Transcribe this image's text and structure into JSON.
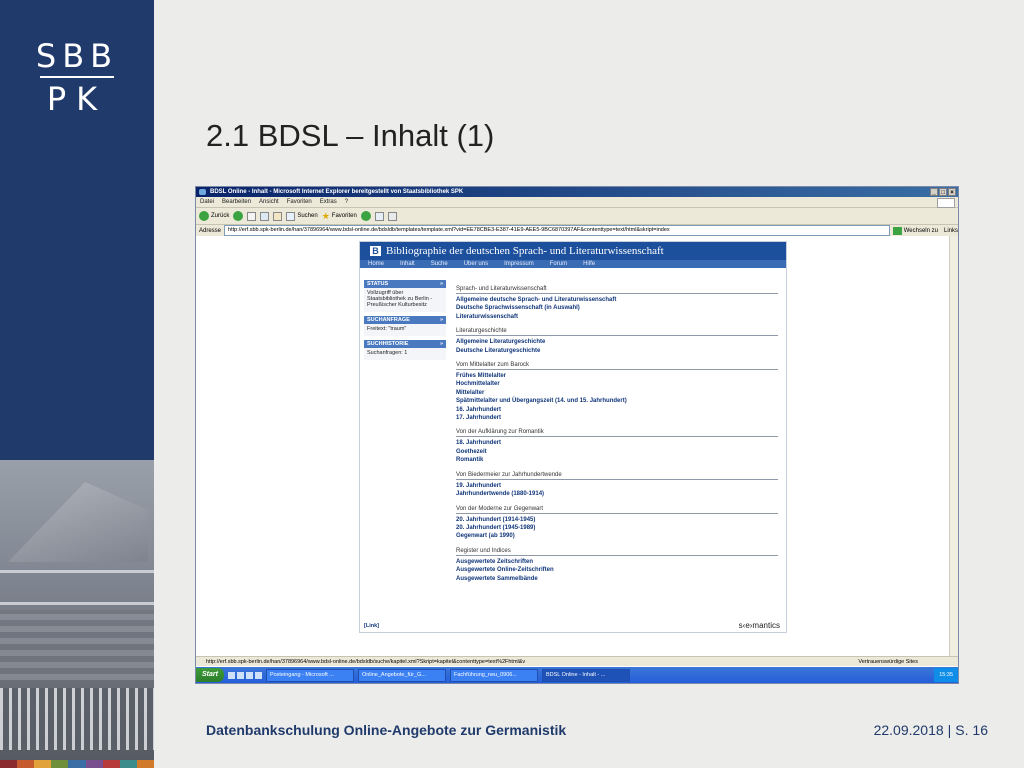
{
  "sidebar": {
    "logo_top": "SBB",
    "logo_bottom": "PK",
    "strip_colors": [
      "#8a2a2e",
      "#c75b30",
      "#e2a23a",
      "#6f8f3a",
      "#3a6ea5",
      "#7a4f8f",
      "#b83b3b",
      "#3d8c8c",
      "#d07a2a"
    ]
  },
  "slide": {
    "title": "2.1 BDSL – Inhalt (1)",
    "footer_left": "Datenbankschulung Online-Angebote zur Germanistik",
    "footer_date": "22.09.2018",
    "footer_sep": "|",
    "footer_page": "S. 16"
  },
  "browser": {
    "title": "BDSL Online - Inhalt - Microsoft Internet Explorer bereitgestellt von Staatsbibliothek SPK",
    "menu": [
      "Datei",
      "Bearbeiten",
      "Ansicht",
      "Favoriten",
      "Extras",
      "?"
    ],
    "back_label": "Zurück",
    "search_label": "Suchen",
    "favorites_label": "Favoriten",
    "address_label": "Adresse",
    "url": "http://erf.sbb.spk-berlin.de/han/37896964/www.bdsl-online.de/bdsldb/templates/template.xml?vid=EE78CBE3-E387-41E9-AEE5-9BC6870397AF&contenttype=text/html&skript=index",
    "go_label": "Wechseln zu",
    "links_label": "Links",
    "status_url": "http://erf.sbb.spk-berlin.de/han/37896964/www.bdsl-online.de/bdsldb/suche/kapitel.xml?Skript=kapitel&contenttype=text%2Fhtml&v",
    "status_zone": "Vertrauenswürdige Sites",
    "start_label": "Start",
    "tasks": [
      "Posteingang - Microsoft ...",
      "Online_Angebote_für_G...",
      "Fachführung_neu_0906...",
      "BDSL Online - Inhalt - ..."
    ],
    "clock": "15:35"
  },
  "bdsl": {
    "header": "Bibliographie der deutschen Sprach- und Literaturwissenschaft",
    "nav": [
      "Home",
      "Inhalt",
      "Suche",
      "Über uns",
      "Impressum",
      "Forum",
      "Hilfe"
    ],
    "status_title": "STATUS",
    "status_text": "Vollzugriff über Staatsbibliothek zu Berlin - Preußischer Kulturbesitz",
    "query_title": "SUCHANFRAGE",
    "query_text": "Freitext: \"traum\"",
    "history_title": "SUCHHISTORIE",
    "history_text": "Suchanfragen: 1",
    "sections": [
      {
        "title": "Sprach- und Literaturwissenschaft",
        "links": [
          "Allgemeine deutsche Sprach- und Literaturwissenschaft",
          "Deutsche Sprachwissenschaft (in Auswahl)",
          "Literaturwissenschaft"
        ]
      },
      {
        "title": "Literaturgeschichte",
        "links": [
          "Allgemeine Literaturgeschichte",
          "Deutsche Literaturgeschichte"
        ]
      },
      {
        "title": "Vom Mittelalter zum Barock",
        "links": [
          "Frühes Mittelalter",
          "Hochmittelalter",
          "Mittelalter",
          "Spätmittelalter und Übergangszeit (14. und 15. Jahrhundert)",
          "16. Jahrhundert",
          "17. Jahrhundert"
        ]
      },
      {
        "title": "Von der Aufklärung zur Romantik",
        "links": [
          "18. Jahrhundert",
          "Goethezeit",
          "Romantik"
        ]
      },
      {
        "title": "Von Biedermeier zur Jahrhundertwende",
        "links": [
          "19. Jahrhundert",
          "Jahrhundertwende (1880-1914)"
        ]
      },
      {
        "title": "Von der Moderne zur Gegenwart",
        "links": [
          "20. Jahrhundert (1914-1945)",
          "20. Jahrhundert (1945-1989)",
          "Gegenwart (ab 1990)"
        ]
      },
      {
        "title": "Register und Indices",
        "links": [
          "Ausgewertete Zeitschriften",
          "Ausgewertete Online-Zeitschriften",
          "Ausgewertete Sammelbände"
        ]
      }
    ],
    "footer_link": "[Link]",
    "footer_brand": "s‹e›mantics"
  }
}
